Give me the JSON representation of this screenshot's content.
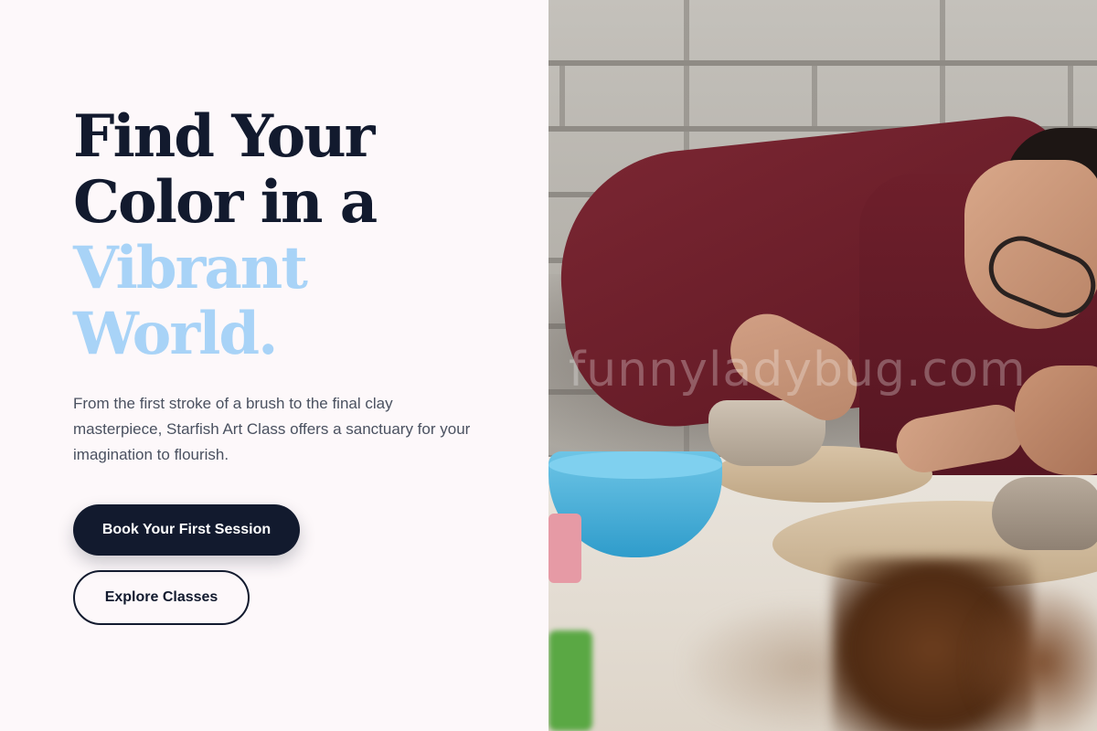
{
  "hero": {
    "headline_line1": "Find Your",
    "headline_line2": "Color in a",
    "headline_accent_line1": "Vibrant",
    "headline_accent_line2": "World.",
    "description": "From the first stroke of a brush to the final clay masterpiece, Starfish Art Class offers a sanctuary for your imagination to flourish.",
    "primary_button_label": "Book Your First Session",
    "secondary_button_label": "Explore Classes"
  },
  "photo": {
    "watermark": "funnyladybug.com"
  },
  "colors": {
    "background": "#fdf8fa",
    "ink": "#121a2e",
    "accent": "#a8d3f7",
    "body_text": "#4a5160"
  }
}
